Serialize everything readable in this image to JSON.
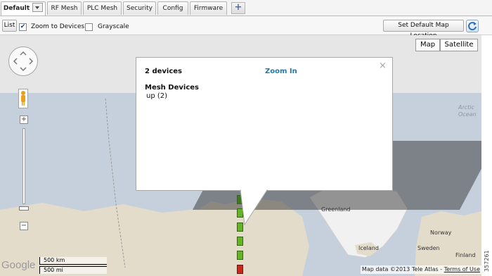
{
  "tabs": {
    "active": "Default",
    "items": [
      "RF Mesh",
      "PLC Mesh",
      "Security",
      "Config",
      "Firmware"
    ],
    "add_label": "+"
  },
  "toolbar": {
    "list_label": "List",
    "zoom_to_devices": {
      "label": "Zoom to Devices",
      "checked": true
    },
    "grayscale": {
      "label": "Grayscale",
      "checked": false
    },
    "set_default_label": "Set Default Map Location"
  },
  "map": {
    "type_buttons": [
      "Map",
      "Satellite"
    ],
    "labels": {
      "arctic_line1": "Arctic",
      "arctic_line2": "Ocean",
      "greenland": "Greenland",
      "iceland": "Iceland",
      "norway": "Norway",
      "sweden": "Sweden",
      "finland": "Finland"
    },
    "google_logo": "Google",
    "scale_km": "500 km",
    "scale_mi": "500 mi",
    "attribution_prefix": "Map data ©2013 Tele Atlas - ",
    "attribution_link": "Terms of Use",
    "zoom_in_label": "+",
    "zoom_out_label": "−"
  },
  "popup": {
    "count": "2 devices",
    "zoom_in": "Zoom In",
    "close": "×",
    "section_title": "Mesh Devices",
    "status_line": "up (2)"
  },
  "figure_id": "357261"
}
